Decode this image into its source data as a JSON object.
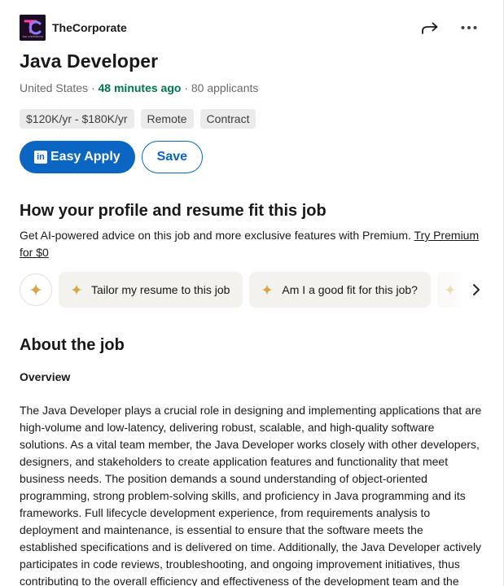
{
  "header": {
    "company": "TheCorporate",
    "logo_text": "THE CORPORATE"
  },
  "job": {
    "title": "Java Developer",
    "location": "United States",
    "separator": " · ",
    "posted": "48 minutes ago",
    "applicants": "80 applicants",
    "pills": [
      "$120K/yr - $180K/yr",
      "Remote",
      "Contract"
    ]
  },
  "buttons": {
    "easy_apply": "Easy Apply",
    "linkedin_glyph": "in",
    "save": "Save"
  },
  "fit": {
    "title": "How your profile and resume fit this job",
    "description": "Get AI-powered advice on this job and more exclusive features with Premium. ",
    "premium_link": "Try Premium for $0",
    "chips": [
      "Tailor my resume to this job",
      "Am I a good fit for this job?"
    ]
  },
  "about": {
    "title": "About the job",
    "subheading": "Overview",
    "body": "The Java Developer plays a crucial role in designing and implementing applications that are high-volume and low-latency, delivering robust, scalable, and high-quality software solutions. As a vital team member, the Java Developer works closely with other developers, designers, and stakeholders to create application features and functionality that meet business needs. The position demands a sound understanding of object-oriented programming, strong problem-solving skills, and proficiency in Java programming and its frameworks. Full lifecycle development experience, from requirements analysis to deployment and maintenance, is essential to ensure that the software meets the established specifications and is delivered on time. Additionally, the Java Developer actively participates in code reviews, troubleshooting, and ongoing improvement initiatives, thus contributing to the overall efficiency and effectiveness of the development team and the"
  },
  "icons": {
    "share": "share-arrow-icon",
    "more": "more-dots-icon",
    "spark": "premium-spark-icon",
    "chevron": "chevron-right-icon"
  },
  "colors": {
    "primary": "#0a66c2",
    "posted_green": "#01754f",
    "spark_gold": "#d9a441",
    "pill_bg": "#ebebeb",
    "chip_bg": "#f3f2ef"
  }
}
